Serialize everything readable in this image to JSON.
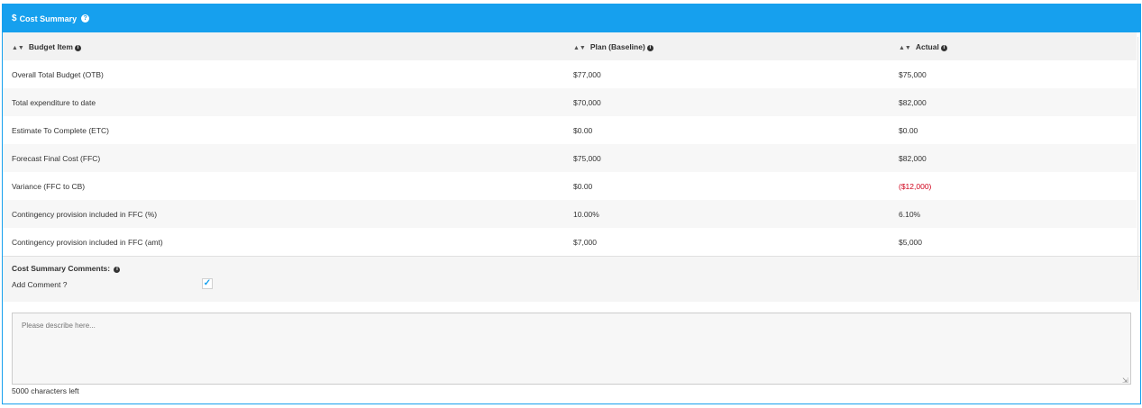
{
  "panel": {
    "title": "Cost Summary",
    "title_icon": "$",
    "help_icon": "?"
  },
  "table": {
    "headers": [
      "Budget Item",
      "Plan (Baseline)",
      "Actual"
    ],
    "rows": [
      {
        "item": "Overall Total Budget (OTB)",
        "plan": "$77,000",
        "actual": "$75,000"
      },
      {
        "item": "Total expenditure to date",
        "plan": "$70,000",
        "actual": "$82,000"
      },
      {
        "item": "Estimate To Complete (ETC)",
        "plan": "$0.00",
        "actual": "$0.00"
      },
      {
        "item": "Forecast Final Cost (FFC)",
        "plan": "$75,000",
        "actual": "$82,000"
      },
      {
        "item": "Variance (FFC to CB)",
        "plan": "$0.00",
        "actual": "($12,000)"
      },
      {
        "item": "Contingency provision included in FFC (%)",
        "plan": "10.00%",
        "actual": "6.10%"
      },
      {
        "item": "Contingency provision included in FFC (amt)",
        "plan": "$7,000",
        "actual": "$5,000"
      }
    ]
  },
  "comments": {
    "title": "Cost Summary Comments:",
    "add_comment_label": "Add Comment ?",
    "add_comment_checked": true,
    "placeholder": "Please describe here...",
    "chars_left": "5000 characters left"
  },
  "colors": {
    "accent": "#16a0ee",
    "negative": "#d0021b"
  }
}
